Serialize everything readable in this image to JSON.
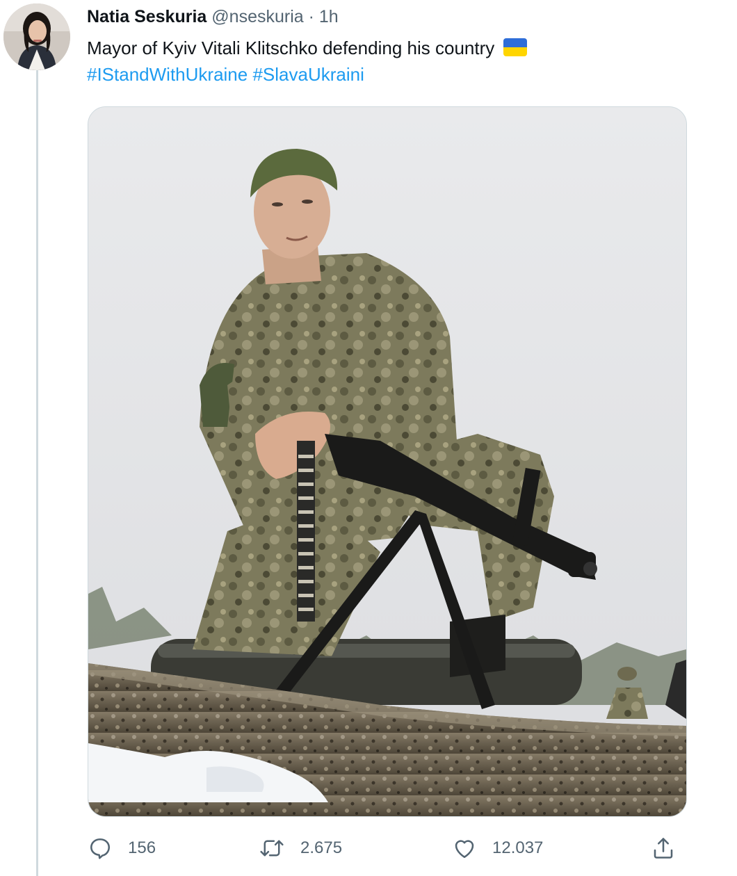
{
  "tweet": {
    "author_name": "Natia Seskuria",
    "author_handle": "@nseskuria",
    "separator": "·",
    "time": "1h",
    "text": "Mayor of Kyiv Vitali Klitschko defending his country",
    "text_emoji_icon": "ukraine-flag-icon",
    "hashtags": [
      "#IStandWithUkraine",
      "#SlavaUkraini"
    ]
  },
  "actions": {
    "reply_count": "156",
    "retweet_count": "2.675",
    "like_count": "12.037",
    "icons": [
      "reply-icon",
      "retweet-icon",
      "like-icon",
      "share-icon"
    ]
  },
  "colors": {
    "link": "#1d9bf0",
    "secondary_text": "#536471",
    "primary_text": "#0f1419",
    "border": "#cfd9de",
    "flag_blue": "#2f6ed8",
    "flag_yellow": "#ffd500"
  }
}
